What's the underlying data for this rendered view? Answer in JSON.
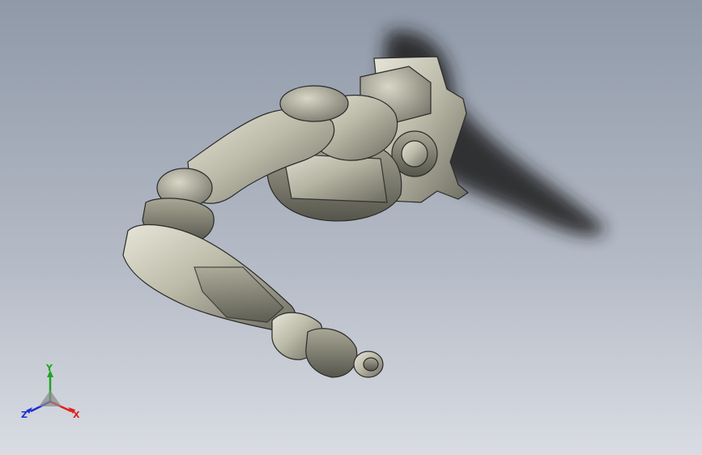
{
  "viewport": {
    "background_top": "#8f99a8",
    "background_bottom": "#d9dce3"
  },
  "model": {
    "name_icon": "robot-arm-3d-model",
    "body_color": "#bdbcae",
    "edge_color": "#2b2b2b",
    "shadow_color": "#1e1e1e"
  },
  "triad": {
    "x_label": "X",
    "y_label": "Y",
    "z_label": "Z",
    "x_color": "#e0201c",
    "y_color": "#1ea51e",
    "z_color": "#1d2fd0"
  }
}
